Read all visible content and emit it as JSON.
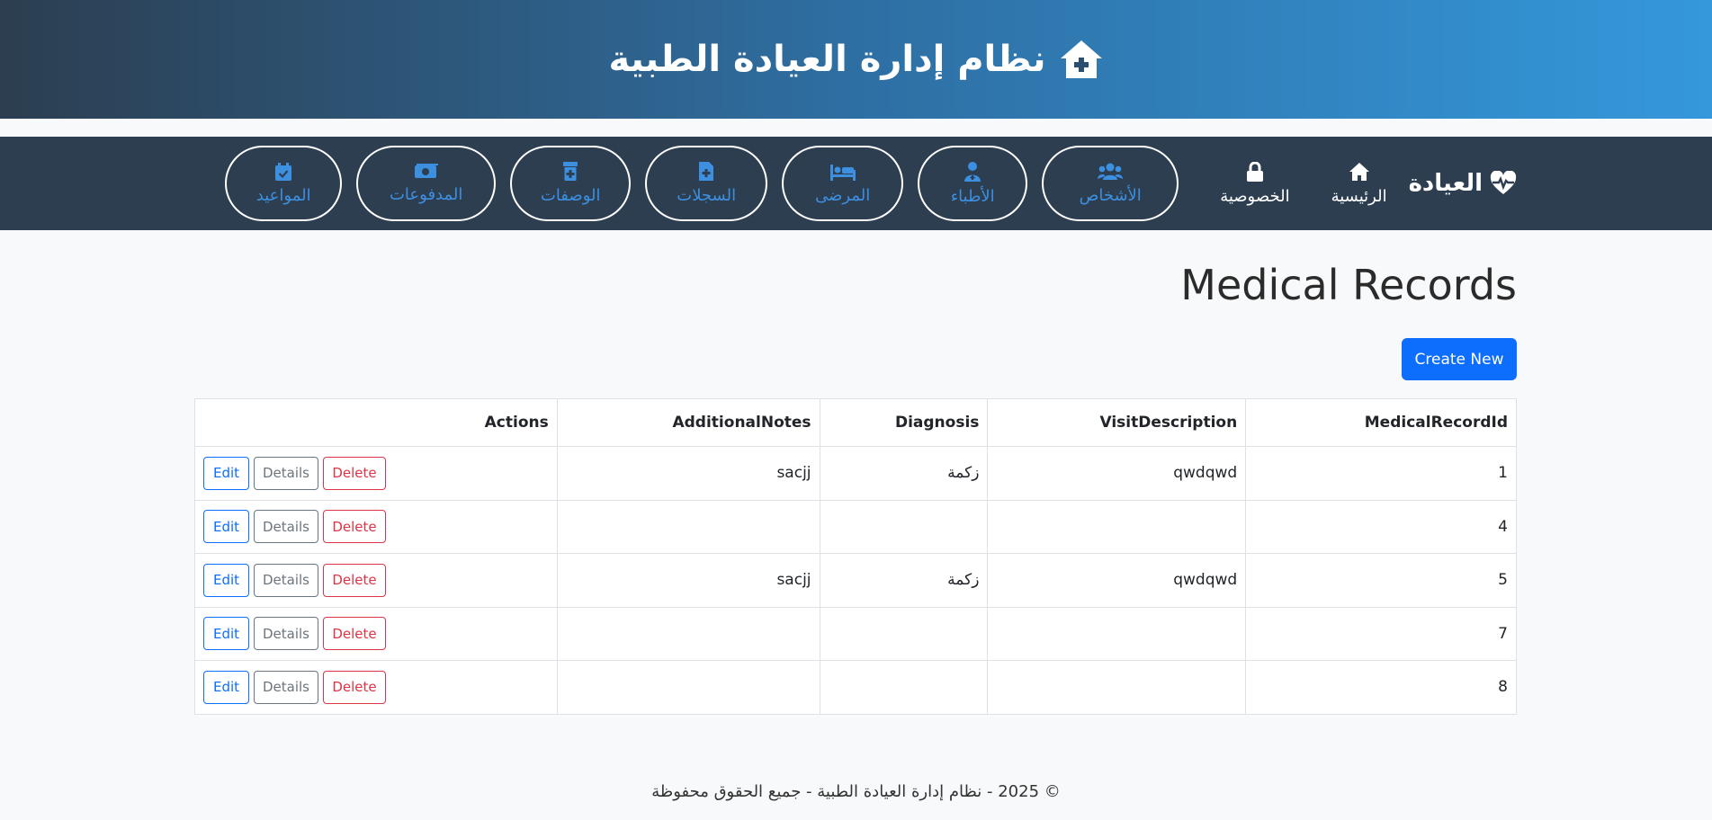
{
  "banner": {
    "title": "نظام إدارة العيادة الطبية",
    "icon": "house-medical-icon"
  },
  "navbar": {
    "brand": {
      "label": "العيادة",
      "icon": "heart-pulse-icon"
    },
    "home": {
      "label": "الرئيسية",
      "icon": "house-icon"
    },
    "privacy": {
      "label": "الخصوصية",
      "icon": "lock-icon"
    },
    "pills": [
      {
        "label": "الأشخاص",
        "icon": "users-icon"
      },
      {
        "label": "الأطباء",
        "icon": "user-doctor-icon"
      },
      {
        "label": "المرضى",
        "icon": "bed-patient-icon"
      },
      {
        "label": "السجلات",
        "icon": "file-medical-icon"
      },
      {
        "label": "الوصفات",
        "icon": "prescription-bottle-icon"
      },
      {
        "label": "المدفوعات",
        "icon": "money-icon"
      },
      {
        "label": "المواعيد",
        "icon": "calendar-check-icon"
      }
    ]
  },
  "page": {
    "title": "Medical Records",
    "create_label": "Create New"
  },
  "table": {
    "headers": {
      "id": "MedicalRecordId",
      "visit": "VisitDescription",
      "diagnosis": "Diagnosis",
      "notes": "AdditionalNotes",
      "actions": "Actions"
    },
    "action_labels": {
      "edit": "Edit",
      "details": "Details",
      "delete": "Delete"
    },
    "rows": [
      {
        "id": "1",
        "visit": "qwdqwd",
        "diagnosis": "زكمة",
        "notes": "sacjj"
      },
      {
        "id": "4",
        "visit": "",
        "diagnosis": "",
        "notes": ""
      },
      {
        "id": "5",
        "visit": "qwdqwd",
        "diagnosis": "زكمة",
        "notes": "sacjj"
      },
      {
        "id": "7",
        "visit": "",
        "diagnosis": "",
        "notes": ""
      },
      {
        "id": "8",
        "visit": "",
        "diagnosis": "",
        "notes": ""
      }
    ]
  },
  "footer": {
    "text": "© 2025 - نظام إدارة العيادة الطبية - جميع الحقوق محفوظة"
  },
  "colors": {
    "navbar": "#2c3e50",
    "primary": "#0d6efd",
    "pill_text": "#3d8fe0",
    "danger": "#dc3545",
    "secondary": "#6c757d"
  }
}
